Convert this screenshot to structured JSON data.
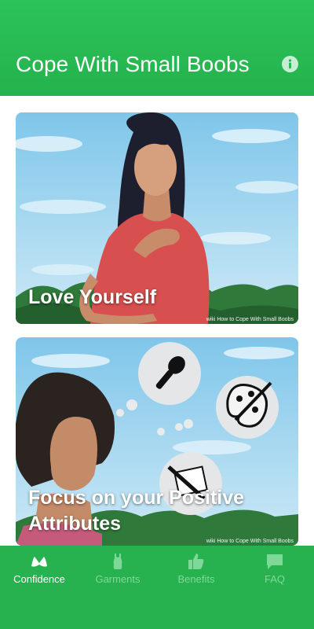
{
  "header": {
    "title": "Cope With Small Boobs",
    "info_icon": "info-icon"
  },
  "cards": [
    {
      "title": "Love Yourself",
      "watermark": "wiki How to Cope With Small Boobs"
    },
    {
      "title": "Focus on your Positive Attributes",
      "watermark": "wiki How to Cope With Small Boobs"
    }
  ],
  "tabs": [
    {
      "label": "Confidence",
      "icon": "bra-icon",
      "active": true
    },
    {
      "label": "Garments",
      "icon": "garment-icon",
      "active": false
    },
    {
      "label": "Benefits",
      "icon": "thumbs-up-icon",
      "active": false
    },
    {
      "label": "FAQ",
      "icon": "chat-bubble-icon",
      "active": false
    }
  ],
  "colors": {
    "brand": "#27b24f",
    "inactive_tab": "#7ed999",
    "card_title": "#ffffff"
  }
}
